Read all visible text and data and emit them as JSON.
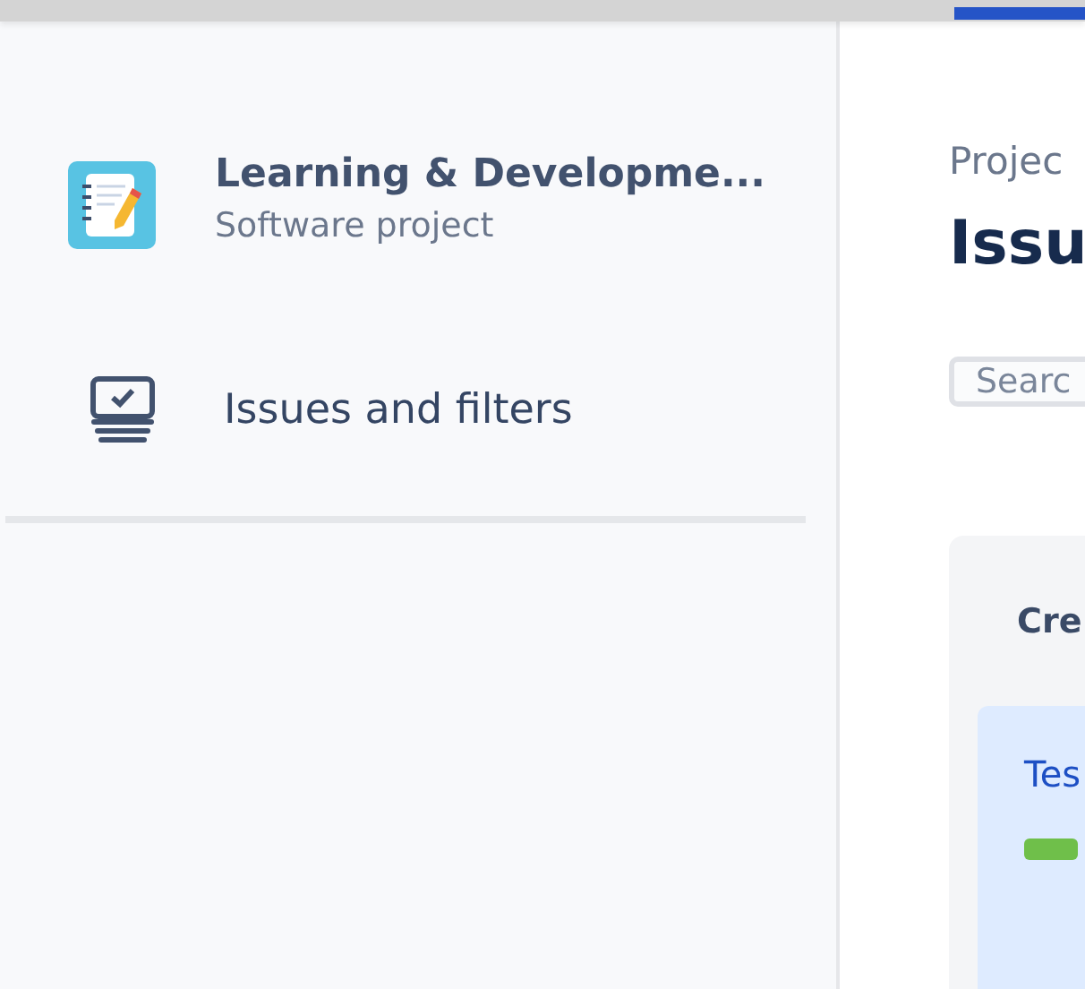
{
  "sidebar": {
    "project": {
      "name": "Learning & Developme...",
      "type": "Software project"
    },
    "items": [
      {
        "label": "Issues and filters",
        "selected": false
      }
    ]
  },
  "main": {
    "breadcrumb": "Projec",
    "title": "Issu",
    "search": {
      "placeholder": "Searc"
    },
    "column": {
      "title": "Cre",
      "cards": [
        {
          "title": "Tes"
        }
      ]
    }
  }
}
